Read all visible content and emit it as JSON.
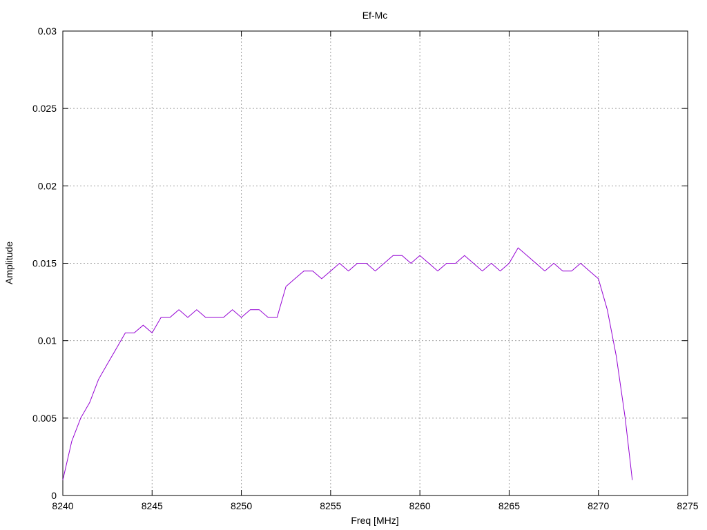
{
  "chart_data": {
    "type": "line",
    "title": "Ef-Mc",
    "xlabel": "Freq [MHz]",
    "ylabel": "Amplitude",
    "xlim": [
      8240,
      8275
    ],
    "ylim": [
      0,
      0.03
    ],
    "x_ticks": [
      8240,
      8245,
      8250,
      8255,
      8260,
      8265,
      8270,
      8275
    ],
    "y_ticks": [
      0,
      0.005,
      0.01,
      0.015,
      0.02,
      0.025,
      0.03
    ],
    "y_tick_labels": [
      "0",
      "0.005",
      "0.01",
      "0.015",
      "0.02",
      "0.025",
      "0.03"
    ],
    "grid": true,
    "line_color": "#9400d3",
    "series": [
      {
        "x": [
          8240.0,
          8240.5,
          8241.0,
          8241.5,
          8242.0,
          8242.5,
          8243.0,
          8243.5,
          8244.0,
          8244.5,
          8245.0,
          8245.5,
          8246.0,
          8246.5,
          8247.0,
          8247.5,
          8248.0,
          8248.5,
          8249.0,
          8249.5,
          8250.0,
          8250.5,
          8251.0,
          8251.5,
          8252.0,
          8252.5,
          8253.0,
          8253.5,
          8254.0,
          8254.5,
          8255.0,
          8255.5,
          8256.0,
          8256.5,
          8257.0,
          8257.5,
          8258.0,
          8258.5,
          8259.0,
          8259.5,
          8260.0,
          8260.5,
          8261.0,
          8261.5,
          8262.0,
          8262.5,
          8263.0,
          8263.5,
          8264.0,
          8264.5,
          8265.0,
          8265.5,
          8266.0,
          8266.5,
          8267.0,
          8267.5,
          8268.0,
          8268.5,
          8269.0,
          8269.5,
          8270.0,
          8270.5,
          8271.0,
          8271.5,
          8271.9
        ],
        "values": [
          0.001,
          0.0035,
          0.005,
          0.006,
          0.0075,
          0.0085,
          0.0095,
          0.0105,
          0.0105,
          0.011,
          0.0105,
          0.0115,
          0.0115,
          0.012,
          0.0115,
          0.012,
          0.0115,
          0.0115,
          0.0115,
          0.012,
          0.0115,
          0.012,
          0.012,
          0.0115,
          0.0115,
          0.0135,
          0.014,
          0.0145,
          0.0145,
          0.014,
          0.0145,
          0.015,
          0.0145,
          0.015,
          0.015,
          0.0145,
          0.015,
          0.0155,
          0.0155,
          0.015,
          0.0155,
          0.015,
          0.0145,
          0.015,
          0.015,
          0.0155,
          0.015,
          0.0145,
          0.015,
          0.0145,
          0.015,
          0.016,
          0.0155,
          0.015,
          0.0145,
          0.015,
          0.0145,
          0.0145,
          0.015,
          0.0145,
          0.014,
          0.012,
          0.009,
          0.005,
          0.001
        ]
      }
    ]
  }
}
